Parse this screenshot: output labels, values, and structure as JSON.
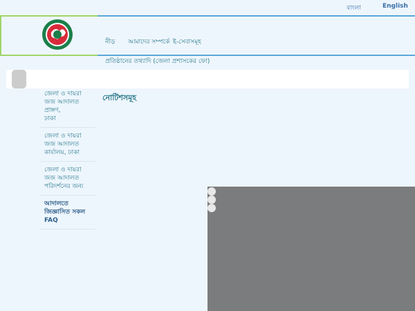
{
  "topbar": {
    "lang_bn": "বাংলা",
    "lang_en": "English"
  },
  "nav": {
    "home": "নীড়",
    "about": "আমাদের সম্পর্কে",
    "services": "ই-সেবাসমূহ",
    "office_info": "প্রতিষ্ঠানের তথ্যাদি (জেলা প্রশাসকের ফো)"
  },
  "sidebar": {
    "items": [
      {
        "lines": [
          "জেলা ও দায়রা",
          "জজ আদালত প্রাঙ্গণ,",
          "ঢাকা"
        ]
      },
      {
        "lines": [
          "জেলা ও দায়রা",
          "জজ আদালত",
          "কার্যালয়, ঢাকা"
        ]
      },
      {
        "lines": [
          "জেলা ও দায়রা",
          "জজ আদালত",
          "পরিদর্শনের জন্য"
        ]
      },
      {
        "lines": [
          "আদালতে",
          "জিজ্ঞাসিত সকল",
          "FAQ"
        ]
      }
    ]
  },
  "main": {
    "title": "নোটিশসমূহ"
  },
  "slider": {
    "dots": 3
  },
  "colors": {
    "page_bg": "#eef6fd",
    "accent_green": "#9fd46a",
    "accent_blue": "#5aa7d8",
    "link": "#2b7a8c",
    "panel_gray": "#7b7c7e"
  },
  "icons": {
    "logo": "court-emblem-icon",
    "search": "search-icon"
  }
}
